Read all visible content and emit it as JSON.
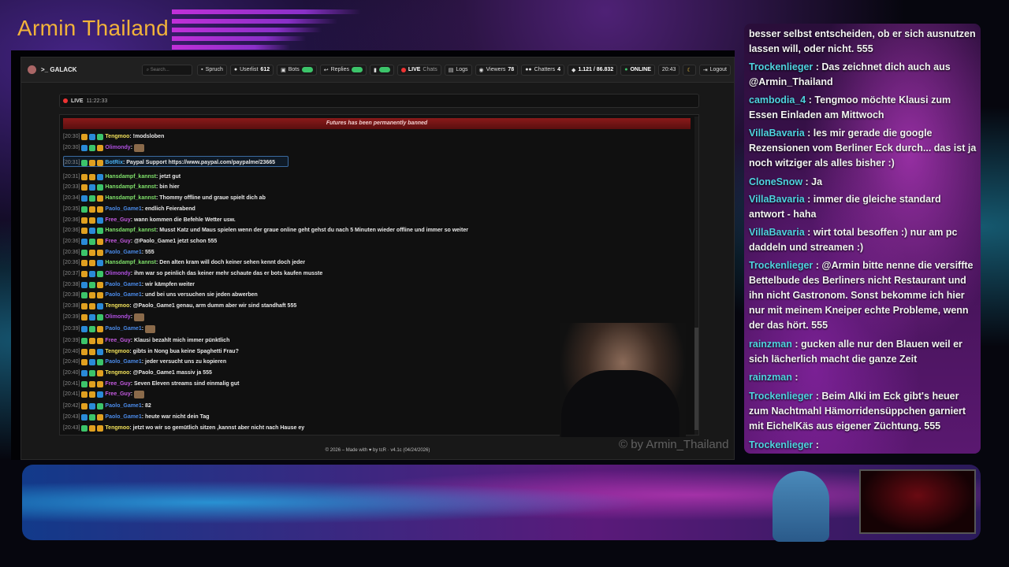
{
  "stream": {
    "title": "Armin Thailand",
    "watermark": "© by Armin_Thailand"
  },
  "navbar": {
    "brand": ">_ GALACK",
    "search_placeholder": "Search...",
    "spruch": "Spruch",
    "userlist_label": "Userlist",
    "userlist_count": "612",
    "bots": "Bots",
    "replies": "Replies",
    "live": "LIVE",
    "chats": "Chats",
    "logs": "Logs",
    "viewers_label": "Viewers",
    "viewers_count": "78",
    "chatters_label": "Chatters",
    "chatters_count": "4",
    "messages": "1.121 / 86.832",
    "status": "ONLINE",
    "time": "20:43",
    "logout": "Logout"
  },
  "livebar": {
    "label": "LIVE",
    "time": "11:22:33"
  },
  "ban_notice": "Futures has been permanently banned",
  "colors": {
    "tengmoo": "#f0e05a",
    "olimondy": "#b050e0",
    "hansdampf": "#7fe06a",
    "paolo": "#4a8ae8",
    "freeguy": "#c45ae0",
    "botrix": "#4ab0f0"
  },
  "messages": [
    {
      "time": "[20:30]",
      "user": "Tengmoo",
      "color": "#f0e05a",
      "text": ": !modsloben"
    },
    {
      "time": "[20:30]",
      "user": "Olimondy",
      "color": "#b050e0",
      "text": ":",
      "emote": true
    },
    {
      "time": "[20:31]",
      "user": "BotRix",
      "color": "#4ab0f0",
      "text": ": Paypal Support https://www.paypal.com/paypalme/23665"
    },
    {
      "time": "[20:31]",
      "user": "Hansdampf_kannst",
      "color": "#7fe06a",
      "text": ": jetzt gut"
    },
    {
      "time": "[20:33]",
      "user": "Hansdampf_kannst",
      "color": "#7fe06a",
      "text": ": bin hier"
    },
    {
      "time": "[20:34]",
      "user": "Hansdampf_kannst",
      "color": "#7fe06a",
      "text": ": Thommy offline und graue spielt dich ab"
    },
    {
      "time": "[20:35]",
      "user": "Paolo_Game1",
      "color": "#4a8ae8",
      "text": ": endlich Feierabend"
    },
    {
      "time": "[20:36]",
      "user": "Free_Guy",
      "color": "#c45ae0",
      "text": ": wann kommen die Befehle Wetter usw."
    },
    {
      "time": "[20:36]",
      "user": "Hansdampf_kannst",
      "color": "#7fe06a",
      "text": ": Musst Katz und Maus spielen wenn der graue online geht gehst du nach 5 Minuten wieder offline und immer so weiter"
    },
    {
      "time": "[20:36]",
      "user": "Free_Guy",
      "color": "#c45ae0",
      "text": ": @Paolo_Game1 jetzt schon 555"
    },
    {
      "time": "[20:36]",
      "user": "Paolo_Game1",
      "color": "#4a8ae8",
      "text": ": 555"
    },
    {
      "time": "[20:36]",
      "user": "Hansdampf_kannst",
      "color": "#7fe06a",
      "text": ": Den alten kram will doch keiner sehen kennt doch jeder"
    },
    {
      "time": "[20:37]",
      "user": "Olimondy",
      "color": "#b050e0",
      "text": ": ihm war so peinlich das keiner mehr schaute das er bots kaufen musste"
    },
    {
      "time": "[20:38]",
      "user": "Paolo_Game1",
      "color": "#4a8ae8",
      "text": ": wir kämpfen weiter"
    },
    {
      "time": "[20:38]",
      "user": "Paolo_Game1",
      "color": "#4a8ae8",
      "text": ": und bei uns versuchen sie jeden abwerben"
    },
    {
      "time": "[20:38]",
      "user": "Tengmoo",
      "color": "#f0e05a",
      "text": ": @Paolo_Game1 genau, arm dumm aber wir sind standhaft 555"
    },
    {
      "time": "[20:39]",
      "user": "Olimondy",
      "color": "#b050e0",
      "text": ":",
      "emote": true
    },
    {
      "time": "[20:39]",
      "user": "Paolo_Game1",
      "color": "#4a8ae8",
      "text": ":",
      "emote": true
    },
    {
      "time": "[20:39]",
      "user": "Free_Guy",
      "color": "#c45ae0",
      "text": ": Klausi bezahlt mich immer pünktlich"
    },
    {
      "time": "[20:40]",
      "user": "Tengmoo",
      "color": "#f0e05a",
      "text": ": gibts in Nong bua keine Spaghetti Frau?"
    },
    {
      "time": "[20:40]",
      "user": "Paolo_Game1",
      "color": "#4a8ae8",
      "text": ": jeder versucht uns zu kopieren"
    },
    {
      "time": "[20:40]",
      "user": "Tengmoo",
      "color": "#f0e05a",
      "text": ": @Paolo_Game1 massiv ja 555"
    },
    {
      "time": "[20:41]",
      "user": "Free_Guy",
      "color": "#c45ae0",
      "text": ": Seven Eleven streams sind einmalig gut"
    },
    {
      "time": "[20:41]",
      "user": "Free_Guy",
      "color": "#c45ae0",
      "text": ":",
      "emote": true
    },
    {
      "time": "[20:42]",
      "user": "Paolo_Game1",
      "color": "#4a8ae8",
      "text": ": 82"
    },
    {
      "time": "[20:43]",
      "user": "Paolo_Game1",
      "color": "#4a8ae8",
      "text": ": heute war nicht dein Tag"
    },
    {
      "time": "[20:43]",
      "user": "Tengmoo",
      "color": "#f0e05a",
      "text": ": jetzt wo wir so gemütlich sitzen ,kannst aber nicht nach Hause ey"
    }
  ],
  "footer": {
    "text": "© 2026 – Made with ♥ by tcR · v4.1c (04/24/2026)"
  },
  "overlay_chat": [
    {
      "user": "",
      "text": "besser selbst entscheiden, ob er sich ausnutzen lassen will, oder nicht. 555"
    },
    {
      "user": "Trockenlieger",
      "text": ": Das zeichnet dich auch aus @Armin_Thailand"
    },
    {
      "user": "cambodia_4",
      "text": ": Tengmoo möchte Klausi zum Essen Einladen am Mittwoch"
    },
    {
      "user": "VillaBavaria",
      "text": ": les mir gerade die google Rezensionen vom Berliner Eck durch... das ist ja noch witziger als alles bisher :)"
    },
    {
      "user": "CloneSnow",
      "text": ": Ja"
    },
    {
      "user": "VillaBavaria",
      "text": ": immer die gleiche standard antwort - haha"
    },
    {
      "user": "VillaBavaria",
      "text": ": wirt total besoffen :) nur am pc daddeln und streamen :)"
    },
    {
      "user": "Trockenlieger",
      "text": ": @Armin bitte nenne die versiffte Bettelbude des Berliners nicht Restaurant und ihn nicht Gastronom. Sonst bekomme ich hier nur mit meinem Kneiper echte Probleme, wenn der das hört. 555"
    },
    {
      "user": "rainzman",
      "text": ": gucken alle nur den Blauen weil er sich lächerlich macht die ganze Zeit"
    },
    {
      "user": "rainzman",
      "text": ":"
    },
    {
      "user": "Trockenlieger",
      "text": ": Beim Alki im Eck gibt's heuer zum Nachtmahl Hämorridensüppchen garniert mit EichelKäs aus eigener Züchtung. 555"
    },
    {
      "user": "Trockenlieger",
      "text": ":"
    }
  ]
}
